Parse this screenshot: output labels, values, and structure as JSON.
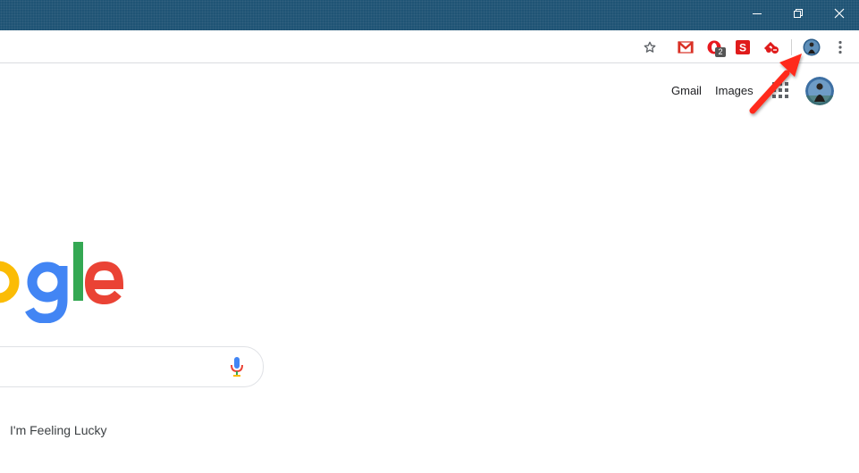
{
  "window_controls": {
    "minimize_icon": "minimize-icon",
    "restore_icon": "restore-icon",
    "close_icon": "close-icon"
  },
  "toolbar": {
    "bookmark_icon": "star-icon",
    "extensions": [
      {
        "name": "gmail-extension-icon",
        "badge": ""
      },
      {
        "name": "opera-extension-icon",
        "badge": "2"
      },
      {
        "name": "s-extension-icon",
        "badge": ""
      },
      {
        "name": "red-extension-icon",
        "badge": ""
      }
    ],
    "profile_icon": "profile-avatar-icon",
    "menu_icon": "three-dots-menu-icon"
  },
  "page": {
    "gmail_label": "Gmail",
    "images_label": "Images",
    "apps_icon": "apps-grid-icon",
    "account_icon": "account-avatar",
    "logo_text": "ogle",
    "mic_icon": "microphone-icon",
    "lucky_label": "I'm Feeling Lucky"
  },
  "colors": {
    "titlebar": "#1f5475",
    "arrow": "#ff2a1a",
    "google_blue": "#4285f4",
    "google_yellow": "#fbbc05",
    "google_green": "#34a853",
    "google_red": "#ea4335"
  }
}
